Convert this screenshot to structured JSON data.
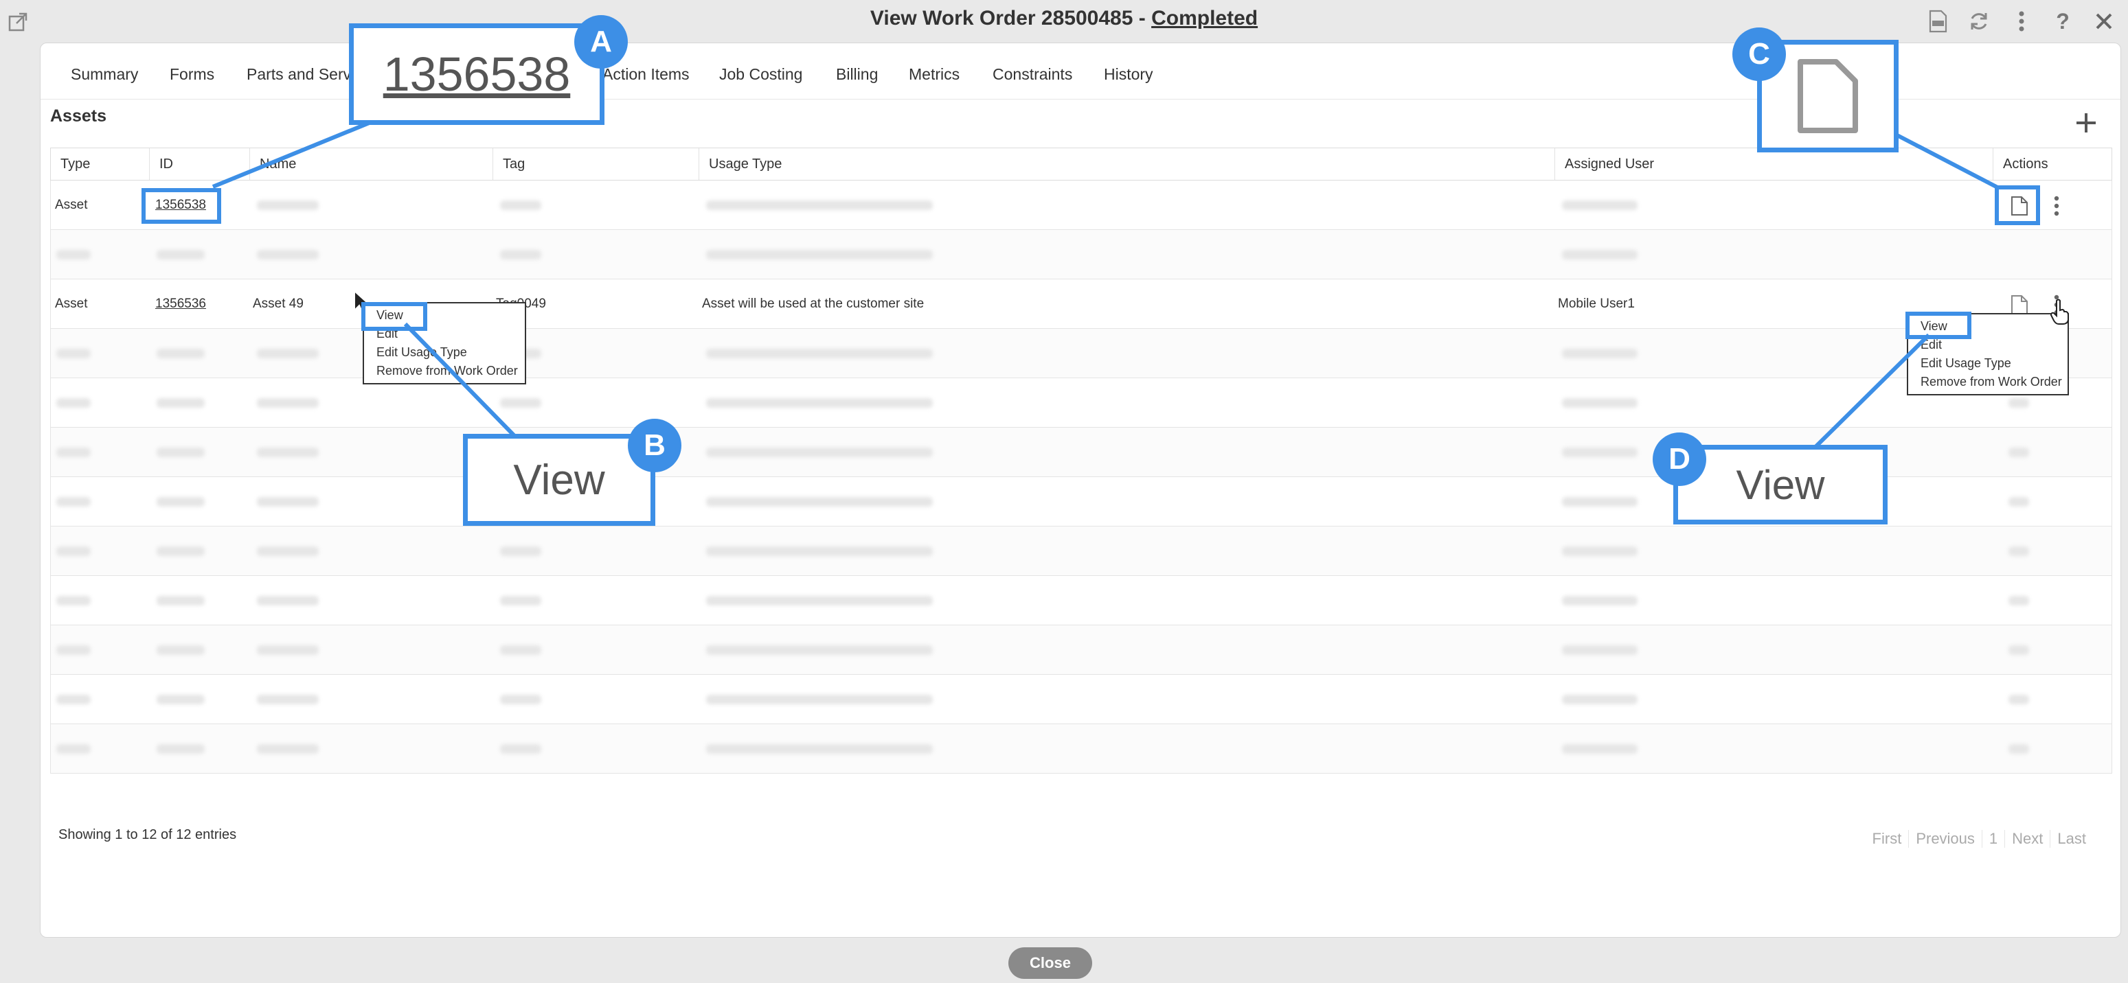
{
  "window": {
    "title_prefix": "View Work Order",
    "order_number": "28500485",
    "separator": "-",
    "status": "Completed"
  },
  "tabs": [
    "Summary",
    "Forms",
    "Parts and Servi",
    "Action Items",
    "Job Costing",
    "Billing",
    "Metrics",
    "Constraints",
    "History"
  ],
  "section": {
    "title": "Assets"
  },
  "table": {
    "headers": [
      "Type",
      "ID",
      "Name",
      "Tag",
      "Usage Type",
      "Assigned User",
      "Actions"
    ],
    "rows": [
      {
        "type": "Asset",
        "id": "1356538",
        "name": "",
        "tag": "",
        "usage": "",
        "user": ""
      },
      {
        "type": "",
        "id": "",
        "name": "",
        "tag": "",
        "usage": "",
        "user": ""
      },
      {
        "type": "Asset",
        "id": "1356536",
        "name": "Asset 49",
        "tag": "Tag0049",
        "usage": "Asset will be used at the customer site",
        "user": "Mobile User1"
      }
    ]
  },
  "footer": {
    "info": "Showing 1 to 12 of 12 entries",
    "pager": [
      "First",
      "Previous",
      "1",
      "Next",
      "Last"
    ]
  },
  "context_menu": {
    "items": [
      "View",
      "Edit",
      "Edit Usage Type",
      "Remove from Work Order"
    ]
  },
  "callouts": {
    "a": {
      "letter": "A",
      "text": "1356538"
    },
    "b": {
      "letter": "B",
      "text": "View"
    },
    "c": {
      "letter": "C"
    },
    "d": {
      "letter": "D",
      "text": "View"
    }
  },
  "buttons": {
    "close": "Close"
  },
  "colors": {
    "callout": "#3d8fe6",
    "close_button": "#8a8a8a"
  }
}
